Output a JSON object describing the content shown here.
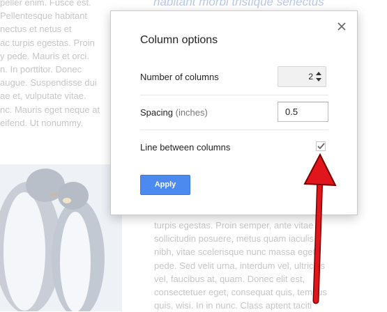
{
  "background": {
    "left_lines": [
      "peller enim. Fusce est.",
      "Pellentesque habitant",
      "nectus et netus et",
      "ac turpis egestas. Proin",
      "y pede. Mauris et orci.",
      "n. In porttitor. Donec",
      "augue. Suspendisse dui",
      "ae et, vulputate vitae.",
      "nc. Mauris eget neque at",
      "eifend. Ut nonummy."
    ],
    "heading": "habitant morbi tristique senectus",
    "right_lines": [
      "turpis egestas. Proin semper, ante vitae",
      "sollicitudin posuere, metus quam iaculis",
      "nibh, vitae scelerisque nunc massa eget",
      "pede. Sed velit urna, interdum vel, ultricies",
      "vel, faucibus at, quam. Donec elit est,",
      "consectetuer eget, consequat quis, tempus",
      "quis, wisi. In in nunc. Class aptent taciti"
    ]
  },
  "dialog": {
    "title": "Column options",
    "columns": {
      "label": "Number of columns",
      "value": "2"
    },
    "spacing": {
      "label": "Spacing",
      "hint": "(inches)",
      "value": "0.5"
    },
    "line_between": {
      "label": "Line between columns",
      "checked": true
    },
    "apply_label": "Apply"
  },
  "colors": {
    "accent": "#4d8af0",
    "annotation_arrow": "#e0161c"
  }
}
